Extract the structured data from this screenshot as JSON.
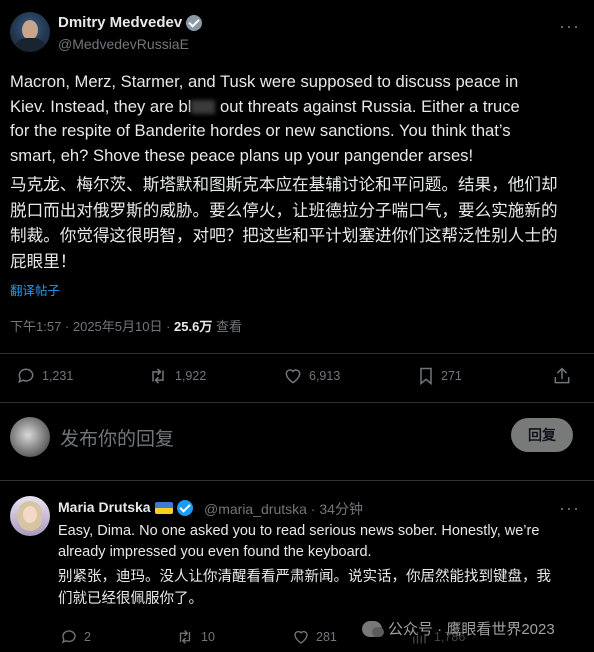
{
  "tweet": {
    "author_name": "Dmitry Medvedev",
    "author_handle": "@MedvedevRussiaE",
    "more_label": "···",
    "text_en_1": "Macron, Merz, Starmer, and Tusk were supposed to discuss peace in",
    "text_en_2": "Kiev. Instead, they are bl",
    "text_en_3": " out threats against Russia. Either a truce",
    "text_en_4": "for the respite of Banderite hordes or new sanctions. You think that’s",
    "text_en_5": "smart, eh? Shove these peace plans up your pangender arses!",
    "text_zh_1": "马克龙、梅尔茨、斯塔默和图斯克本应在基辅讨论和平问题。结果，他们却",
    "text_zh_2": "脱口而出对俄罗斯的威胁。要么停火，让班德拉分子喘口气，要么实施新的",
    "text_zh_3": "制裁。你觉得这很明智，对吧？把这些和平计划塞进你们这帮泛性别人士的",
    "text_zh_4": "屁眼里！",
    "translate_label": "翻译帖子",
    "time": "下午1:57 · 2025年5月10日 · ",
    "views": "25.6万",
    "views_suffix": " 查看",
    "actions": {
      "replies": "1,231",
      "reposts": "1,922",
      "likes": "6,913",
      "bookmarks": "271"
    }
  },
  "composer": {
    "placeholder": "发布你的回复",
    "reply_button": "回复"
  },
  "reply": {
    "author_name": "Maria Drutska",
    "author_handle": "@maria_drutska",
    "time_sep": " · ",
    "time": "34分钟",
    "text_en_1": "Easy, Dima. No one asked you to read serious news sober. Honestly, we’re",
    "text_en_2": "already impressed you even found the keyboard.",
    "text_zh_1": "别紧张，迪玛。没人让你清醒看看严肃新闻。说实话，你居然能找到键盘，我",
    "text_zh_2": "们就已经很佩服你了。",
    "actions": {
      "replies": "2",
      "reposts": "10",
      "likes": "281",
      "views": "1,786"
    }
  },
  "watermark": {
    "text": "公众号 · 鹰眼看世界2023"
  },
  "colors": {
    "background": "#000000",
    "text": "#e7e9ea",
    "muted": "#71767b",
    "accent": "#1d9bf0",
    "divider": "#2f3336"
  }
}
